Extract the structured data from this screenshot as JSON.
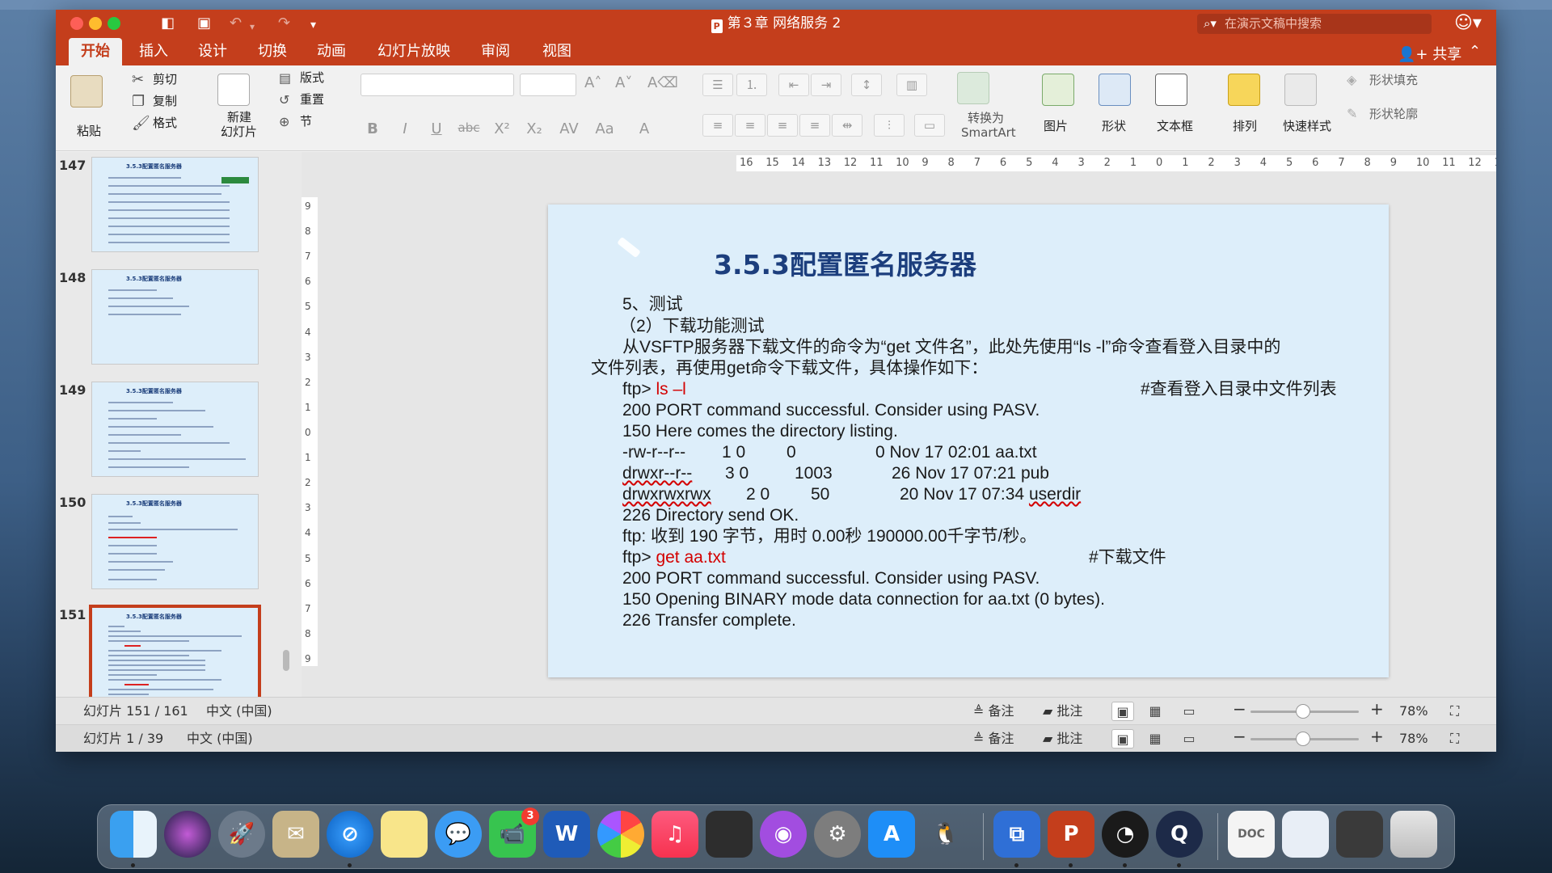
{
  "window": {
    "doc_title": "第３章 网络服务 2",
    "search_placeholder": "在演示文稿中搜索"
  },
  "tabs": [
    {
      "label": "开始",
      "active": true
    },
    {
      "label": "插入"
    },
    {
      "label": "设计"
    },
    {
      "label": "切换"
    },
    {
      "label": "动画"
    },
    {
      "label": "幻灯片放映"
    },
    {
      "label": "审阅"
    },
    {
      "label": "视图"
    }
  ],
  "share_label": "共享",
  "ribbon": {
    "paste": "粘贴",
    "cut": "剪切",
    "copy": "复制",
    "format": "格式",
    "new_slide_1": "新建",
    "new_slide_2": "幻灯片",
    "layout": "版式",
    "reset": "重置",
    "section": "节",
    "smartart_1": "转换为",
    "smartart_2": "SmartArt",
    "picture": "图片",
    "shape": "形状",
    "textbox": "文本框",
    "arrange": "排列",
    "quick_styles": "快速样式",
    "shape_fill": "形状填充",
    "shape_outline": "形状轮廓"
  },
  "thumbnails": [
    {
      "number": "147",
      "title": "3.5.3配置匿名服务器"
    },
    {
      "number": "148",
      "title": "3.5.3配置匿名服务器"
    },
    {
      "number": "149",
      "title": "3.5.3配置匿名服务器"
    },
    {
      "number": "150",
      "title": "3.5.3配置匿名服务器"
    },
    {
      "number": "151",
      "title": "3.5.3配置匿名服务器",
      "selected": true
    }
  ],
  "ruler": {
    "h_ticks": [
      "16",
      "15",
      "14",
      "13",
      "12",
      "11",
      "10",
      "9",
      "8",
      "7",
      "6",
      "5",
      "4",
      "3",
      "2",
      "1",
      "0",
      "1",
      "2",
      "3",
      "4",
      "5",
      "6",
      "7",
      "8",
      "9",
      "10",
      "11",
      "12",
      "13",
      "14",
      "15",
      "16"
    ],
    "v_ticks": [
      "9",
      "8",
      "7",
      "6",
      "5",
      "4",
      "3",
      "2",
      "1",
      "0",
      "1",
      "2",
      "3",
      "4",
      "5",
      "6",
      "7",
      "8",
      "9"
    ]
  },
  "slide": {
    "title": "3.5.3配置匿名服务器",
    "lines": [
      {
        "text": "5、测试"
      },
      {
        "text": "（2）下载功能测试"
      },
      {
        "text": "从VSFTP服务器下载文件的命令为“get 文件名”，此处先使用“ls -l”命令查看登入目录中的"
      },
      {
        "text": "文件列表，再使用get命令下载文件，具体操作如下："
      },
      {
        "prefix": "ftp> ",
        "cmd": "ls –l",
        "comment": "#查看登入目录中文件列表"
      },
      {
        "text": "200 PORT command successful. Consider using PASV."
      },
      {
        "text": "150 Here comes the directory listing."
      },
      {
        "perm": "-rw-r--r--",
        "c1": "1 0",
        "c2": "0",
        "c3": "0 Nov 17 02:01 aa.txt"
      },
      {
        "perm": "drwxr--r--",
        "c1": "3 0",
        "c2": "1003",
        "c3": "26 Nov 17 07:21 pub"
      },
      {
        "perm": "drwxrwxrwx",
        "c1": "2 0",
        "c2": "50",
        "c3": "20 Nov 17 07:34 ",
        "c3b": "userdir"
      },
      {
        "text": "226 Directory send OK."
      },
      {
        "text": "ftp: 收到 190 字节，用时 0.00秒 190000.00千字节/秒。"
      },
      {
        "prefix": "ftp> ",
        "cmd": "get aa.txt",
        "comment": "#下载文件"
      },
      {
        "text": "200 PORT command successful. Consider using PASV."
      },
      {
        "text": "150 Opening BINARY mode data connection for aa.txt (0 bytes)."
      },
      {
        "text": "226 Transfer complete."
      }
    ]
  },
  "status_main": {
    "slide_counter": "幻灯片 151 / 161",
    "language": "中文 (中国)",
    "notes": "备注",
    "comments": "批注",
    "zoom": "78%"
  },
  "status_back": {
    "slide_counter": "幻灯片 1 / 39",
    "language": "中文 (中国)",
    "notes": "备注",
    "comments": "批注",
    "zoom": "78%"
  },
  "dock": {
    "facetime_badge": "3"
  },
  "colors": {
    "ppt_red": "#c43e1c",
    "slide_bg": "#ddeefa",
    "title_blue": "#1c3e7d",
    "command_red": "#d30000"
  }
}
